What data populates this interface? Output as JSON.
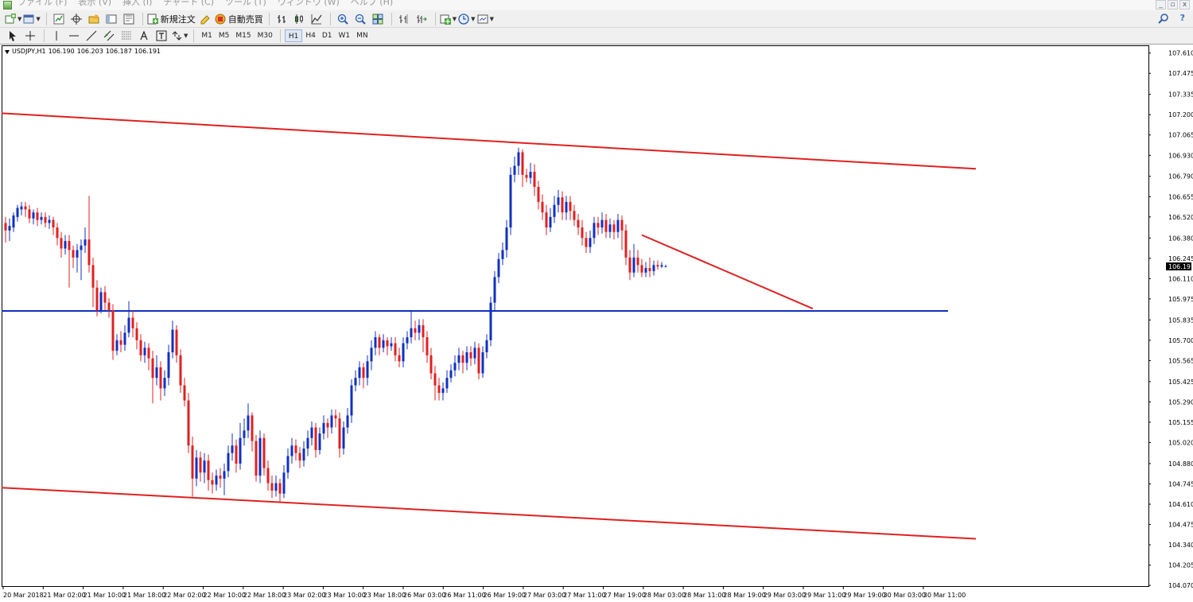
{
  "menu": {
    "items": [
      "ファイル (F)",
      "表示 (V)",
      "挿入 (I)",
      "チャート (C)",
      "ツール (T)",
      "ウィンドウ (W)",
      "ヘルプ (H)"
    ],
    "window_buttons": [
      "_",
      "▫",
      "x"
    ]
  },
  "toolbar": {
    "new_order_label": "新規注文",
    "auto_trade_label": "自動売買",
    "timeframes": [
      "M1",
      "M5",
      "M15",
      "M30",
      "H1",
      "H4",
      "D1",
      "W1",
      "MN"
    ],
    "active_timeframe": "H1"
  },
  "chart_data": {
    "type": "candlestick",
    "symbol_header": {
      "symbol": "USDJPY,H1",
      "open": "106.190",
      "high": "106.203",
      "low": "106.187",
      "close": "106.191"
    },
    "current_price_label": "106.191",
    "ylim": [
      104.06,
      107.64
    ],
    "price_ticks": [
      "107.610",
      "107.475",
      "107.335",
      "107.200",
      "107.065",
      "106.930",
      "106.790",
      "106.655",
      "106.520",
      "106.380",
      "106.245",
      "106.110",
      "105.975",
      "105.835",
      "105.700",
      "105.565",
      "105.425",
      "105.290",
      "105.155",
      "105.020",
      "104.880",
      "104.745",
      "104.610",
      "104.475",
      "104.340",
      "104.205",
      "104.070"
    ],
    "time_ticks": [
      "20 Mar 2018",
      "21 Mar 02:00",
      "21 Mar 10:00",
      "21 Mar 18:00",
      "22 Mar 02:00",
      "22 Mar 10:00",
      "22 Mar 18:00",
      "23 Mar 02:00",
      "23 Mar 10:00",
      "23 Mar 18:00",
      "26 Mar 03:00",
      "26 Mar 11:00",
      "26 Mar 19:00",
      "27 Mar 03:00",
      "27 Mar 11:00",
      "27 Mar 19:00",
      "28 Mar 03:00",
      "28 Mar 11:00",
      "28 Mar 19:00",
      "29 Mar 03:00",
      "29 Mar 11:00",
      "29 Mar 19:00",
      "30 Mar 03:00",
      "30 Mar 11:00"
    ],
    "candles": [
      [
        106.48,
        106.43,
        106.52,
        106.35
      ],
      [
        106.43,
        106.46,
        106.51,
        106.36
      ],
      [
        106.45,
        106.53,
        106.55,
        106.42
      ],
      [
        106.52,
        106.58,
        106.6,
        106.49
      ],
      [
        106.57,
        106.59,
        106.62,
        106.53
      ],
      [
        106.59,
        106.57,
        106.62,
        106.52
      ],
      [
        106.57,
        106.51,
        106.6,
        106.48
      ],
      [
        106.51,
        106.55,
        106.57,
        106.47
      ],
      [
        106.55,
        106.5,
        106.58,
        106.46
      ],
      [
        106.5,
        106.52,
        106.55,
        106.47
      ],
      [
        106.52,
        106.48,
        106.55,
        106.45
      ],
      [
        106.48,
        106.5,
        106.53,
        106.44
      ],
      [
        106.5,
        106.45,
        106.52,
        106.4
      ],
      [
        106.45,
        106.38,
        106.48,
        106.33
      ],
      [
        106.38,
        106.31,
        106.42,
        106.25
      ],
      [
        106.31,
        106.36,
        106.4,
        106.27
      ],
      [
        106.36,
        106.3,
        106.4,
        106.05
      ],
      [
        106.3,
        106.25,
        106.33,
        106.18
      ],
      [
        106.25,
        106.3,
        106.34,
        106.15
      ],
      [
        106.3,
        106.33,
        106.37,
        106.1
      ],
      [
        106.33,
        106.37,
        106.45,
        106.28
      ],
      [
        106.37,
        106.2,
        106.66,
        106.15
      ],
      [
        106.2,
        106.05,
        106.25,
        105.92
      ],
      [
        106.05,
        105.9,
        106.1,
        105.86
      ],
      [
        105.9,
        106.02,
        106.05,
        105.88
      ],
      [
        106.02,
        105.95,
        106.06,
        105.9
      ],
      [
        105.95,
        105.9,
        105.98,
        105.85
      ],
      [
        105.9,
        105.63,
        105.94,
        105.57
      ],
      [
        105.63,
        105.7,
        105.74,
        105.6
      ],
      [
        105.7,
        105.67,
        105.76,
        105.62
      ],
      [
        105.67,
        105.75,
        105.8,
        105.63
      ],
      [
        105.75,
        105.85,
        105.96,
        105.72
      ],
      [
        105.85,
        105.78,
        105.9,
        105.72
      ],
      [
        105.78,
        105.7,
        105.82,
        105.64
      ],
      [
        105.7,
        105.6,
        105.74,
        105.56
      ],
      [
        105.6,
        105.65,
        105.69,
        105.55
      ],
      [
        105.65,
        105.58,
        105.68,
        105.5
      ],
      [
        105.58,
        105.45,
        105.63,
        105.28
      ],
      [
        105.45,
        105.52,
        105.6,
        105.4
      ],
      [
        105.52,
        105.38,
        105.56,
        105.3
      ],
      [
        105.38,
        105.45,
        105.5,
        105.33
      ],
      [
        105.45,
        105.62,
        105.67,
        105.4
      ],
      [
        105.62,
        105.77,
        105.83,
        105.58
      ],
      [
        105.77,
        105.6,
        105.8,
        105.55
      ],
      [
        105.6,
        105.4,
        105.64,
        105.35
      ],
      [
        105.4,
        105.3,
        105.45,
        105.26
      ],
      [
        105.3,
        105.0,
        105.35,
        104.95
      ],
      [
        105.0,
        104.78,
        105.06,
        104.66
      ],
      [
        104.78,
        104.92,
        104.97,
        104.73
      ],
      [
        104.92,
        104.82,
        104.96,
        104.76
      ],
      [
        104.82,
        104.9,
        104.95,
        104.75
      ],
      [
        104.9,
        104.77,
        104.94,
        104.7
      ],
      [
        104.77,
        104.74,
        104.82,
        104.68
      ],
      [
        104.74,
        104.8,
        104.84,
        104.7
      ],
      [
        104.8,
        104.78,
        104.85,
        104.72
      ],
      [
        104.78,
        104.83,
        104.88,
        104.67
      ],
      [
        104.83,
        104.95,
        105.0,
        104.79
      ],
      [
        104.95,
        105.0,
        105.08,
        104.9
      ],
      [
        105.0,
        104.88,
        105.04,
        104.82
      ],
      [
        104.88,
        105.05,
        105.15,
        104.84
      ],
      [
        105.05,
        105.1,
        105.18,
        105.0
      ],
      [
        105.1,
        105.2,
        105.28,
        105.05
      ],
      [
        105.2,
        105.03,
        105.22,
        104.96
      ],
      [
        105.03,
        104.8,
        105.07,
        104.76
      ],
      [
        104.8,
        105.05,
        105.1,
        104.75
      ],
      [
        105.05,
        104.85,
        105.08,
        104.8
      ],
      [
        104.85,
        104.75,
        104.9,
        104.7
      ],
      [
        104.75,
        104.7,
        104.8,
        104.65
      ],
      [
        104.7,
        104.75,
        104.8,
        104.66
      ],
      [
        104.75,
        104.68,
        104.78,
        104.62
      ],
      [
        104.68,
        104.82,
        104.87,
        104.65
      ],
      [
        104.82,
        104.93,
        104.98,
        104.78
      ],
      [
        104.93,
        105.0,
        105.05,
        104.88
      ],
      [
        105.0,
        104.95,
        105.04,
        104.9
      ],
      [
        104.95,
        104.9,
        104.99,
        104.85
      ],
      [
        104.9,
        104.98,
        105.03,
        104.86
      ],
      [
        104.98,
        105.05,
        105.1,
        104.93
      ],
      [
        105.05,
        105.12,
        105.16,
        105.0
      ],
      [
        105.12,
        104.97,
        105.15,
        104.92
      ],
      [
        104.97,
        105.08,
        105.12,
        104.94
      ],
      [
        105.08,
        105.15,
        105.2,
        105.04
      ],
      [
        105.15,
        105.12,
        105.18,
        105.05
      ],
      [
        105.12,
        105.2,
        105.24,
        105.08
      ],
      [
        105.2,
        105.18,
        105.24,
        105.12
      ],
      [
        105.18,
        104.98,
        105.22,
        104.92
      ],
      [
        104.98,
        105.12,
        105.16,
        104.94
      ],
      [
        105.12,
        105.2,
        105.25,
        105.08
      ],
      [
        105.2,
        105.4,
        105.44,
        105.15
      ],
      [
        105.4,
        105.45,
        105.5,
        105.36
      ],
      [
        105.45,
        105.52,
        105.56,
        105.4
      ],
      [
        105.52,
        105.45,
        105.55,
        105.38
      ],
      [
        105.45,
        105.56,
        105.6,
        105.4
      ],
      [
        105.56,
        105.65,
        105.7,
        105.5
      ],
      [
        105.65,
        105.72,
        105.76,
        105.6
      ],
      [
        105.72,
        105.65,
        105.74,
        105.6
      ],
      [
        105.65,
        105.7,
        105.74,
        105.62
      ],
      [
        105.7,
        105.66,
        105.72,
        105.6
      ],
      [
        105.66,
        105.68,
        105.72,
        105.63
      ],
      [
        105.68,
        105.6,
        105.72,
        105.56
      ],
      [
        105.6,
        105.56,
        105.65,
        105.52
      ],
      [
        105.56,
        105.68,
        105.72,
        105.52
      ],
      [
        105.68,
        105.72,
        105.76,
        105.64
      ],
      [
        105.72,
        105.78,
        105.9,
        105.68
      ],
      [
        105.78,
        105.75,
        105.83,
        105.7
      ],
      [
        105.75,
        105.8,
        105.84,
        105.7
      ],
      [
        105.8,
        105.72,
        105.84,
        105.62
      ],
      [
        105.72,
        105.6,
        105.76,
        105.55
      ],
      [
        105.6,
        105.48,
        105.65,
        105.44
      ],
      [
        105.48,
        105.4,
        105.53,
        105.3
      ],
      [
        105.4,
        105.35,
        105.45,
        105.3
      ],
      [
        105.35,
        105.38,
        105.42,
        105.3
      ],
      [
        105.38,
        105.45,
        105.5,
        105.35
      ],
      [
        105.45,
        105.5,
        105.54,
        105.42
      ],
      [
        105.5,
        105.55,
        105.6,
        105.46
      ],
      [
        105.55,
        105.6,
        105.65,
        105.5
      ],
      [
        105.6,
        105.55,
        105.63,
        105.48
      ],
      [
        105.55,
        105.62,
        105.66,
        105.5
      ],
      [
        105.62,
        105.58,
        105.66,
        105.53
      ],
      [
        105.58,
        105.65,
        105.69,
        105.54
      ],
      [
        105.65,
        105.48,
        105.68,
        105.44
      ],
      [
        105.48,
        105.62,
        105.66,
        105.45
      ],
      [
        105.62,
        105.7,
        105.74,
        105.58
      ],
      [
        105.7,
        105.95,
        105.99,
        105.66
      ],
      [
        105.95,
        106.12,
        106.16,
        105.9
      ],
      [
        106.12,
        106.24,
        106.28,
        106.08
      ],
      [
        106.24,
        106.3,
        106.35,
        106.2
      ],
      [
        106.3,
        106.45,
        106.5,
        106.25
      ],
      [
        106.45,
        106.8,
        106.85,
        106.4
      ],
      [
        106.8,
        106.86,
        106.92,
        106.75
      ],
      [
        106.86,
        106.95,
        106.98,
        106.8
      ],
      [
        106.95,
        106.8,
        106.97,
        106.72
      ],
      [
        106.8,
        106.78,
        106.84,
        106.75
      ],
      [
        106.78,
        106.82,
        106.88,
        106.74
      ],
      [
        106.82,
        106.72,
        106.87,
        106.66
      ],
      [
        106.72,
        106.62,
        106.76,
        106.57
      ],
      [
        106.62,
        106.55,
        106.67,
        106.5
      ],
      [
        106.55,
        106.45,
        106.6,
        106.4
      ],
      [
        106.45,
        106.52,
        106.58,
        106.42
      ],
      [
        106.52,
        106.6,
        106.66,
        106.48
      ],
      [
        106.6,
        106.65,
        106.7,
        106.55
      ],
      [
        106.65,
        106.55,
        106.69,
        106.5
      ],
      [
        106.55,
        106.62,
        106.66,
        106.5
      ],
      [
        106.62,
        106.56,
        106.66,
        106.5
      ],
      [
        106.56,
        106.5,
        106.6,
        106.46
      ],
      [
        106.5,
        106.45,
        106.54,
        106.4
      ],
      [
        106.45,
        106.38,
        106.5,
        106.33
      ],
      [
        106.38,
        106.32,
        106.42,
        106.28
      ],
      [
        106.32,
        106.38,
        106.43,
        106.28
      ],
      [
        106.38,
        106.48,
        106.52,
        106.34
      ],
      [
        106.48,
        106.45,
        106.52,
        106.4
      ],
      [
        106.45,
        106.5,
        106.55,
        106.41
      ],
      [
        106.5,
        106.42,
        106.54,
        106.38
      ],
      [
        106.42,
        106.47,
        106.51,
        106.38
      ],
      [
        106.47,
        106.42,
        106.5,
        106.37
      ],
      [
        106.42,
        106.5,
        106.54,
        106.38
      ],
      [
        106.5,
        106.43,
        106.53,
        106.3
      ],
      [
        106.43,
        106.25,
        106.47,
        106.2
      ],
      [
        106.25,
        106.15,
        106.3,
        106.1
      ],
      [
        106.15,
        106.25,
        106.34,
        106.12
      ],
      [
        106.25,
        106.2,
        106.3,
        106.15
      ],
      [
        106.2,
        106.15,
        106.24,
        106.12
      ],
      [
        106.15,
        106.18,
        106.22,
        106.12
      ],
      [
        106.18,
        106.16,
        106.25,
        106.12
      ],
      [
        106.16,
        106.2,
        106.23,
        106.13
      ],
      [
        106.2,
        106.19,
        106.23,
        106.17
      ],
      [
        106.19,
        106.2,
        106.22,
        106.18
      ],
      [
        106.19,
        106.191,
        106.203,
        106.187
      ]
    ],
    "trendlines": [
      {
        "name": "upper-channel",
        "color": "#e02020",
        "p1": [
          -1,
          107.21
        ],
        "p2": [
          244,
          106.84
        ]
      },
      {
        "name": "lower-channel",
        "color": "#e02020",
        "p1": [
          -1,
          104.72
        ],
        "p2": [
          244,
          104.38
        ]
      },
      {
        "name": "support",
        "color": "#1030c0",
        "p1": [
          -1,
          105.895
        ],
        "p2": [
          237,
          105.895
        ]
      },
      {
        "name": "descending-line",
        "color": "#e02020",
        "p1": [
          160,
          106.4
        ],
        "p2": [
          203,
          105.91
        ]
      }
    ],
    "colors": {
      "bull": "#1030c0",
      "bear": "#e02020",
      "support": "#1030c0",
      "channel": "#e02020"
    }
  }
}
